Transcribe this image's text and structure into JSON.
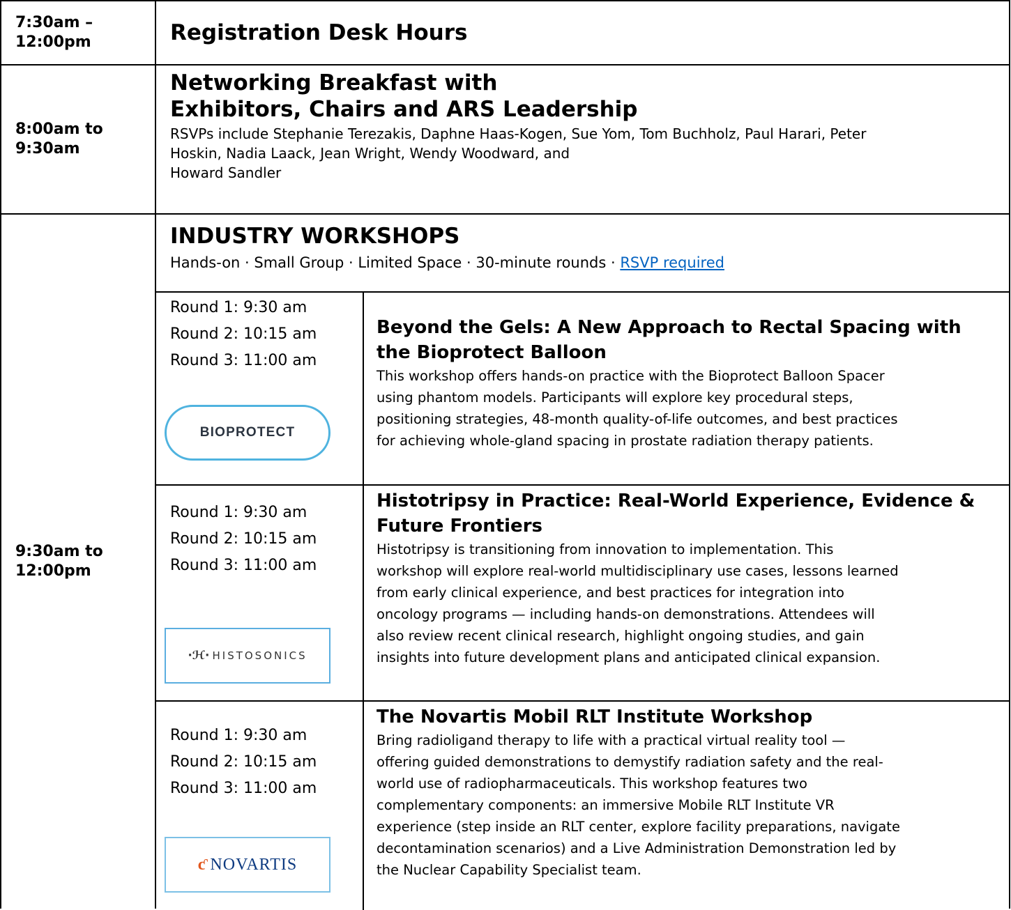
{
  "rows": [
    {
      "time": "7:30am – 12:00pm",
      "title": "Registration Desk Hours"
    },
    {
      "time": "8:00am to 9:30am",
      "title_line1": "Networking Breakfast with",
      "title_line2": "Exhibitors, Chairs and ARS Leadership",
      "body_line1": "RSVPs include Stephanie Terezakis, Daphne Haas-Kogen, Sue Yom, Tom Buchholz, Paul Harari, Peter",
      "body_line2": "Hoskin, Nadia Laack, Jean Wright, Wendy Woodward, and",
      "body_line3": "Howard Sandler"
    },
    {
      "time": "9:30am to 12:00pm",
      "title": "INDUSTRY WORKSHOPS",
      "tagline": "Hands-on · Small Group · Limited Space · 30-minute rounds · ",
      "rsvp_link": "RSVP required"
    }
  ],
  "rounds": [
    "Round 1: 9:30 am",
    "Round 2: 10:15 am",
    "Round 3: 11:00 am"
  ],
  "workshops": [
    {
      "title_line1": "Beyond the Gels: A New Approach to Rectal Spacing with",
      "title_line2": "the Bioprotect Balloon",
      "desc": [
        "This workshop offers hands-on practice with the Bioprotect Balloon Spacer",
        "using phantom models. Participants will explore key procedural steps,",
        "positioning strategies, 48-month quality-of-life outcomes, and best practices",
        "for achieving whole-gland spacing in prostate radiation therapy patients."
      ],
      "logo": "BIOPROTECT"
    },
    {
      "title_line1": "Histotripsy in Practice: Real-World Experience, Evidence &",
      "title_line2": "Future Frontiers",
      "desc": [
        "Histotripsy is transitioning from innovation to implementation. This",
        "workshop will explore real-world multidisciplinary use cases, lessons learned",
        "from early clinical experience, and best practices for integration into",
        "oncology programs — including hands-on demonstrations. Attendees will",
        "also review recent clinical research, highlight ongoing studies, and gain",
        "insights into future development plans and anticipated clinical expansion."
      ],
      "logo": "HISTOSONICS"
    },
    {
      "title_line1": "The Novartis Mobil RLT Institute Workshop",
      "desc": [
        "Bring radioligand therapy to life with a practical virtual reality tool —",
        "offering guided demonstrations to demystify radiation safety and the real-",
        "world use of radiopharmaceuticals. This workshop features two",
        "complementary components: an immersive Mobile RLT Institute VR",
        "experience (step inside an RLT center, explore facility preparations, navigate",
        "decontamination scenarios) and a Live Administration Demonstration led by",
        "the Nuclear Capability Specialist team."
      ],
      "logo": "NOVARTIS"
    }
  ],
  "colors": {
    "link": "#0563c1",
    "bioprotect_border": "#4fb3df",
    "novartis_blue": "#0d3a80",
    "novartis_orange": "#e2571e"
  },
  "icons": {
    "histosonics_mark": "waveform-icon",
    "novartis_mark": "flame-icon"
  }
}
